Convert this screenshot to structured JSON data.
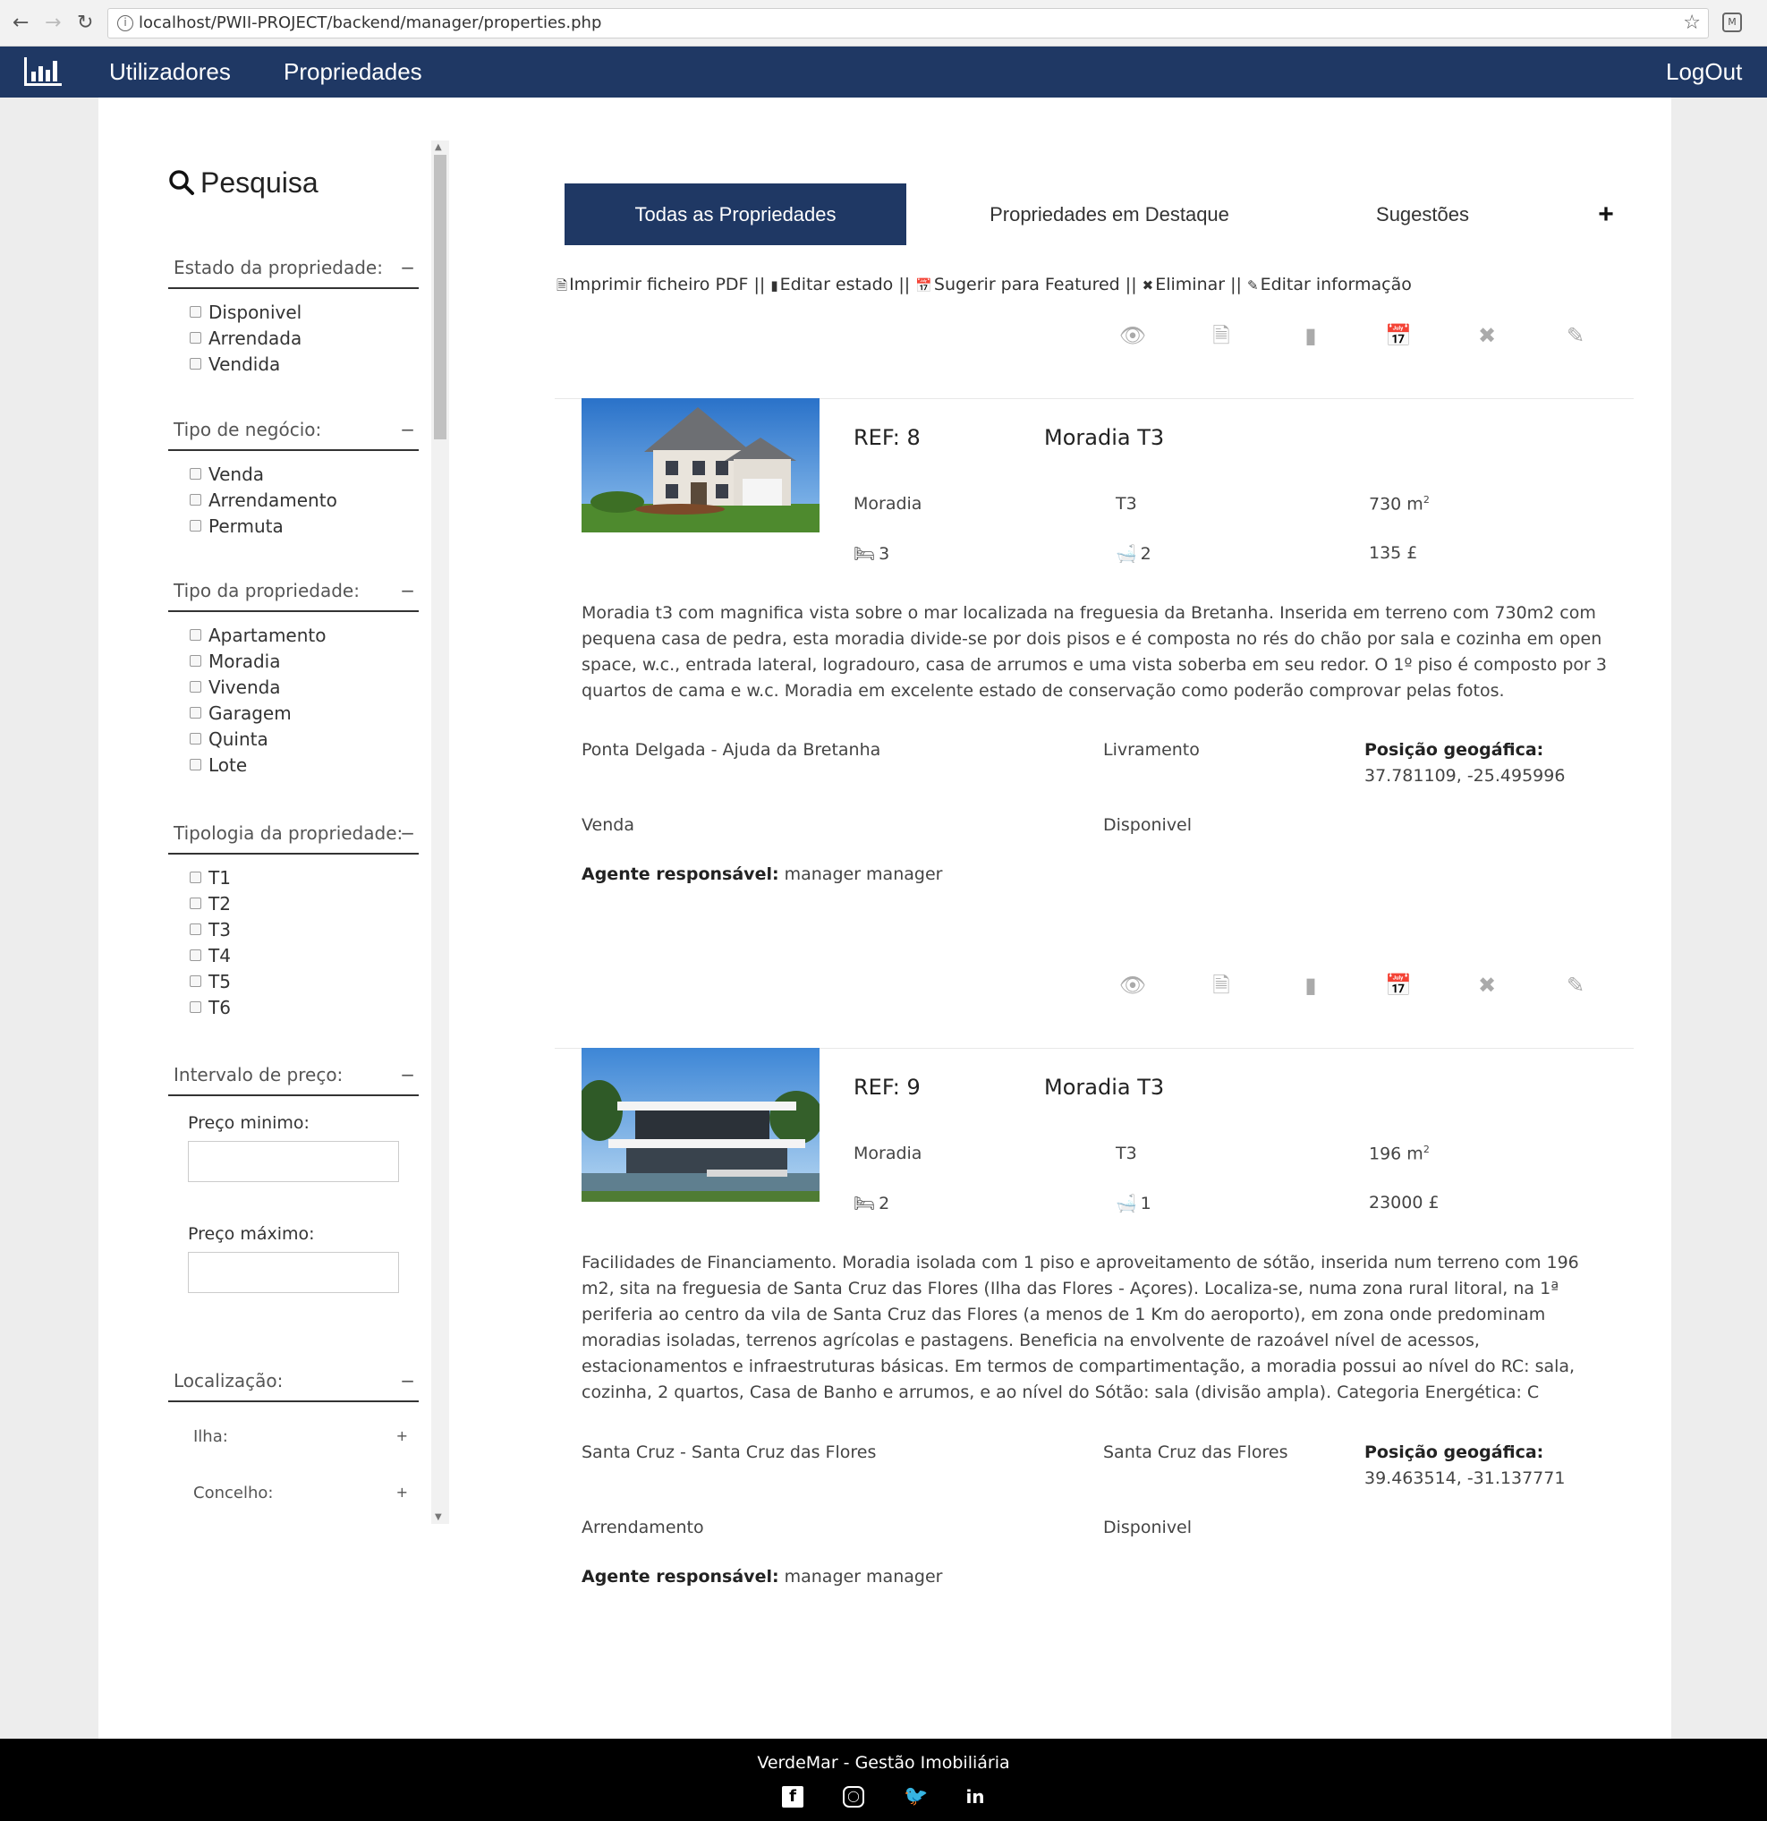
{
  "browser": {
    "url": "localhost/PWII-PROJECT/backend/manager/properties.php"
  },
  "nav": {
    "links": [
      "Utilizadores",
      "Propriedades"
    ],
    "logout": "LogOut"
  },
  "sidebar": {
    "search_title": "Pesquisa",
    "groups": [
      {
        "title": "Estado da propriedade:",
        "toggle": "−",
        "options": [
          "Disponivel",
          "Arrendada",
          "Vendida"
        ]
      },
      {
        "title": "Tipo de negócio:",
        "toggle": "−",
        "options": [
          "Venda",
          "Arrendamento",
          "Permuta"
        ]
      },
      {
        "title": "Tipo da propriedade:",
        "toggle": "−",
        "options": [
          "Apartamento",
          "Moradia",
          "Vivenda",
          "Garagem",
          "Quinta",
          "Lote"
        ]
      },
      {
        "title": "Tipologia da propriedade:",
        "toggle": "−",
        "options": [
          "T1",
          "T2",
          "T3",
          "T4",
          "T5",
          "T6"
        ]
      }
    ],
    "price": {
      "title": "Intervalo de preço:",
      "toggle": "−",
      "min_label": "Preço minimo:",
      "max_label": "Preço máximo:",
      "min_value": "",
      "max_value": ""
    },
    "location": {
      "title": "Localização:",
      "toggle": "−",
      "island": "Ilha:",
      "council": "Concelho:",
      "expand": "+"
    }
  },
  "tabs": [
    {
      "label": "Todas as Propriedades",
      "active": true
    },
    {
      "label": "Propriedades em Destaque",
      "active": false
    },
    {
      "label": "Sugestões",
      "active": false
    }
  ],
  "add_label": "+",
  "legend": {
    "pdf": "Imprimir ficheiro PDF",
    "state": "Editar estado",
    "suggest": "Sugerir para Featured",
    "delete": "Eliminar",
    "edit": "Editar informação",
    "separator": "||"
  },
  "properties": [
    {
      "ref": "REF: 8",
      "title": "Moradia T3",
      "type": "Moradia",
      "typology": "T3",
      "area": "730 m",
      "area_unit_sup": "2",
      "bedrooms": "3",
      "bathrooms": "2",
      "price": "135 £",
      "description": "Moradia t3 com magnifica vista sobre o mar localizada na freguesia da Bretanha. Inserida em terreno com 730m2 com pequena casa de pedra, esta moradia divide-se por dois pisos e é composta no rés do chão por sala e cozinha em open space, w.c., entrada lateral, logradouro, casa de arrumos e uma vista soberba em seu redor. O 1º piso é composto por 3 quartos de cama e w.c. Moradia em excelente estado de conservação como poderão comprovar pelas fotos.",
      "location": "Ponta Delgada - Ajuda da Bretanha",
      "parish": "Livramento",
      "geo_label": "Posição geogáfica:",
      "geo": "37.781109, -25.495996",
      "business": "Venda",
      "state": "Disponivel",
      "agent_label": "Agente responsável:",
      "agent": "manager manager"
    },
    {
      "ref": "REF: 9",
      "title": "Moradia T3",
      "type": "Moradia",
      "typology": "T3",
      "area": "196 m",
      "area_unit_sup": "2",
      "bedrooms": "2",
      "bathrooms": "1",
      "price": "23000 £",
      "description": "Facilidades de Financiamento. Moradia isolada com 1 piso e aproveitamento de sótão, inserida num terreno com 196 m2, sita na freguesia de Santa Cruz das Flores (Ilha das Flores - Açores). Localiza-se, numa zona rural litoral, na 1ª periferia ao centro da vila de Santa Cruz das Flores (a menos de 1 Km do aeroporto), em zona onde predominam moradias isoladas, terrenos agrícolas e pastagens. Beneficia na envolvente de razoável nível de acessos, estacionamentos e infraestruturas básicas. Em termos de compartimentação, a moradia possui ao nível do RC: sala, cozinha, 2 quartos, Casa de Banho e arrumos, e ao nível do Sótão: sala (divisão ampla). Categoria Energética: C",
      "location": "Santa Cruz - Santa Cruz das Flores",
      "parish": "Santa Cruz das Flores",
      "geo_label": "Posição geogáfica:",
      "geo": "39.463514, -31.137771",
      "business": "Arrendamento",
      "state": "Disponivel",
      "agent_label": "Agente responsável:",
      "agent": "manager manager"
    }
  ],
  "footer": {
    "text": "VerdeMar - Gestão Imobiliária",
    "social": [
      "facebook-icon",
      "instagram-icon",
      "twitter-icon",
      "linkedin-icon"
    ]
  },
  "colors": {
    "nav": "#1f3864",
    "footer": "#000000",
    "icon_grey": "#aaaaaa"
  }
}
